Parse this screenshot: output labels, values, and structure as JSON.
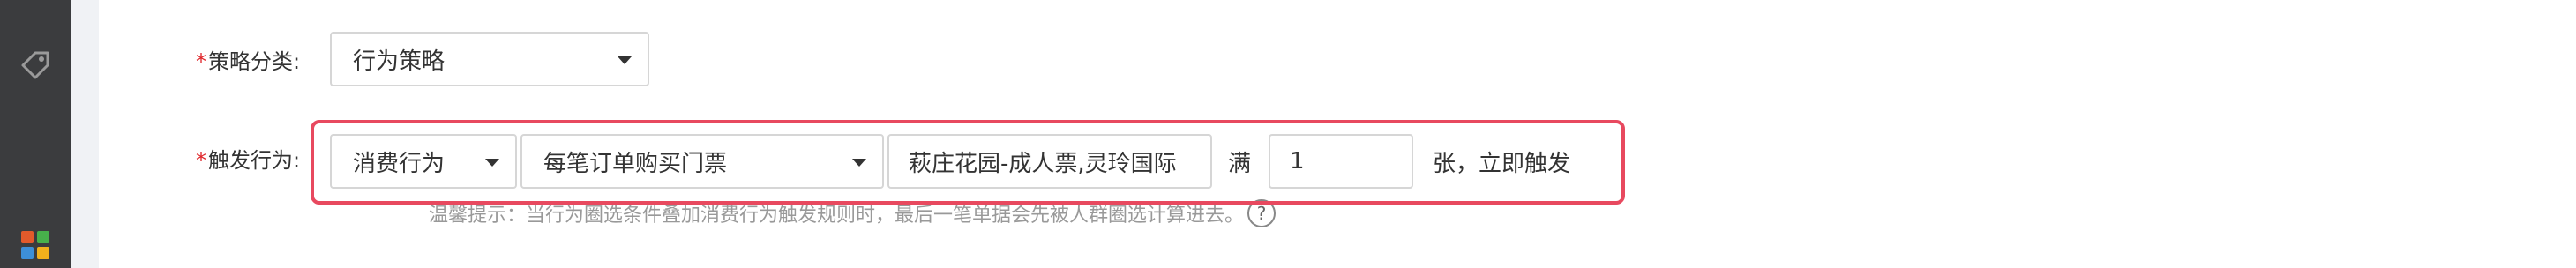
{
  "sidebar": {
    "icons": [
      "tag-icon",
      "apps-icon"
    ],
    "apps_colors": [
      "#e25a2b",
      "#47b04b",
      "#3d8fd8",
      "#f2b01c"
    ]
  },
  "form": {
    "category": {
      "label": "策略分类:",
      "required_mark": "*",
      "value": "行为策略"
    },
    "trigger": {
      "label": "触发行为:",
      "required_mark": "*",
      "behavior_select": "消费行为",
      "condition_select": "每笔订单购买门票",
      "products_value": "萩庄花园-成人票,灵玲国际",
      "full_label": "满",
      "quantity_value": "1",
      "suffix_text": "张，立即触发"
    },
    "hint": "温馨提示：当行为圈选条件叠加消费行为触发规则时，最后一笔单据会先被人群圈选计算进去。",
    "help_icon": "?"
  },
  "colors": {
    "required": "#e0282c",
    "highlight": "#e8495f",
    "sidebar": "#3b3c3e"
  }
}
